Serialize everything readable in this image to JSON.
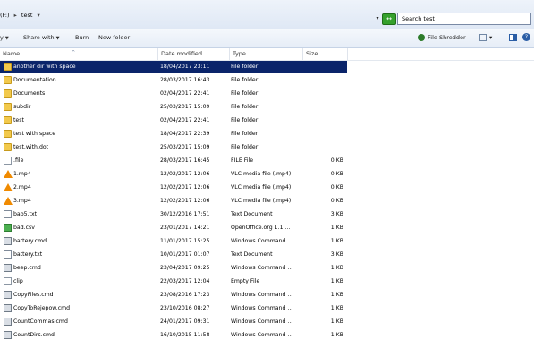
{
  "address": {
    "drive": "(F:)",
    "folder": "test",
    "search_placeholder": "Search test",
    "refresh_label": "↔"
  },
  "toolbar": {
    "partial_label": "y",
    "share_label": "Share with",
    "burn_label": "Burn",
    "new_folder_label": "New folder",
    "shredder_label": "File Shredder"
  },
  "columns": {
    "name": "Name",
    "date": "Date modified",
    "type": "Type",
    "size": "Size"
  },
  "files": [
    {
      "name": "another dir with space",
      "date": "18/04/2017 23:11",
      "type": "File folder",
      "size": "",
      "icon": "folder-icon",
      "selected": true
    },
    {
      "name": "Documentation",
      "date": "28/03/2017 16:43",
      "type": "File folder",
      "size": "",
      "icon": "folder-icon"
    },
    {
      "name": "Documents",
      "date": "02/04/2017 22:41",
      "type": "File folder",
      "size": "",
      "icon": "folder-icon"
    },
    {
      "name": "subdir",
      "date": "25/03/2017 15:09",
      "type": "File folder",
      "size": "",
      "icon": "folder-icon"
    },
    {
      "name": "test",
      "date": "02/04/2017 22:41",
      "type": "File folder",
      "size": "",
      "icon": "folder-icon"
    },
    {
      "name": "test with space",
      "date": "18/04/2017 22:39",
      "type": "File folder",
      "size": "",
      "icon": "folder-icon"
    },
    {
      "name": "test.with.dot",
      "date": "25/03/2017 15:09",
      "type": "File folder",
      "size": "",
      "icon": "folder-icon"
    },
    {
      "name": ".file",
      "date": "28/03/2017 16:45",
      "type": "FILE File",
      "size": "0 KB",
      "icon": "file-icon"
    },
    {
      "name": "1.mp4",
      "date": "12/02/2017 12:06",
      "type": "VLC media file (.mp4)",
      "size": "0 KB",
      "icon": "vlc-icon"
    },
    {
      "name": "2.mp4",
      "date": "12/02/2017 12:06",
      "type": "VLC media file (.mp4)",
      "size": "0 KB",
      "icon": "vlc-icon"
    },
    {
      "name": "3.mp4",
      "date": "12/02/2017 12:06",
      "type": "VLC media file (.mp4)",
      "size": "0 KB",
      "icon": "vlc-icon"
    },
    {
      "name": "bab5.txt",
      "date": "30/12/2016 17:51",
      "type": "Text Document",
      "size": "3 KB",
      "icon": "text-file-icon"
    },
    {
      "name": "bad.csv",
      "date": "23/01/2017 14:21",
      "type": "OpenOffice.org 1.1....",
      "size": "1 KB",
      "icon": "csv-icon"
    },
    {
      "name": "battery.cmd",
      "date": "11/01/2017 15:25",
      "type": "Windows Command ...",
      "size": "1 KB",
      "icon": "cmd-icon"
    },
    {
      "name": "battery.txt",
      "date": "10/01/2017 01:07",
      "type": "Text Document",
      "size": "3 KB",
      "icon": "text-file-icon"
    },
    {
      "name": "beep.cmd",
      "date": "23/04/2017 09:25",
      "type": "Windows Command ...",
      "size": "1 KB",
      "icon": "cmd-icon"
    },
    {
      "name": "clip",
      "date": "22/03/2017 12:04",
      "type": "Empty File",
      "size": "1 KB",
      "icon": "file-icon"
    },
    {
      "name": "CopyFiles.cmd",
      "date": "23/08/2016 17:23",
      "type": "Windows Command ...",
      "size": "1 KB",
      "icon": "cmd-icon"
    },
    {
      "name": "CopyToRejepow.cmd",
      "date": "23/10/2016 08:27",
      "type": "Windows Command ...",
      "size": "1 KB",
      "icon": "cmd-icon"
    },
    {
      "name": "CountCommas.cmd",
      "date": "24/01/2017 09:31",
      "type": "Windows Command ...",
      "size": "1 KB",
      "icon": "cmd-icon"
    },
    {
      "name": "CountDirs.cmd",
      "date": "16/10/2015 11:58",
      "type": "Windows Command ...",
      "size": "1 KB",
      "icon": "cmd-icon"
    }
  ]
}
